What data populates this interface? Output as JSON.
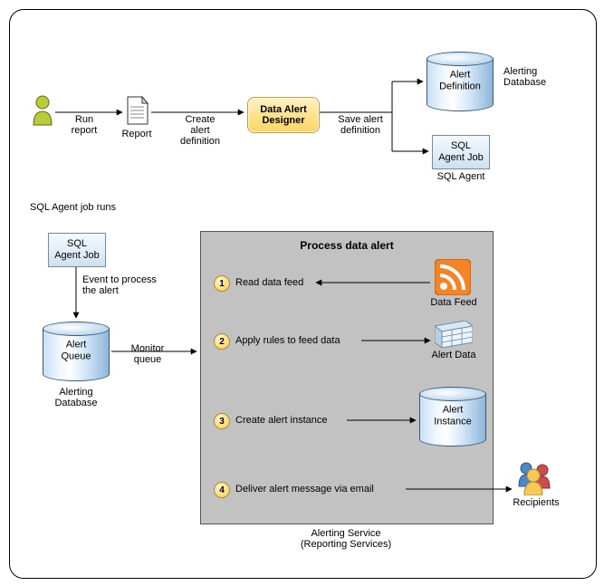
{
  "top": {
    "run_report": "Run\nreport",
    "report_label": "Report",
    "create_def": "Create\nalert\ndefinition",
    "designer": "Data Alert\nDesigner",
    "save_def": "Save alert\ndefinition",
    "alert_def_cyl": "Alert\nDefinition",
    "alerting_db_label": "Alerting\nDatabase",
    "sql_job": "SQL\nAgent Job",
    "sql_agent_label": "SQL Agent"
  },
  "mid": {
    "sql_runs": "SQL Agent job runs",
    "sql_job": "SQL\nAgent Job",
    "event_process": "Event to process\nthe alert",
    "alert_queue": "Alert\nQueue",
    "alerting_db_label": "Alerting\nDatabase",
    "monitor_queue": "Monitor\nqueue"
  },
  "process": {
    "title": "Process data alert",
    "steps": [
      {
        "num": "1",
        "label": "Read data feed",
        "target": "Data Feed"
      },
      {
        "num": "2",
        "label": "Apply rules to feed data",
        "target": "Alert Data"
      },
      {
        "num": "3",
        "label": "Create alert instance",
        "target": "Alert\nInstance"
      },
      {
        "num": "4",
        "label": "Deliver alert message via email",
        "target": ""
      }
    ],
    "service_label": "Alerting Service\n(Reporting Services)",
    "recipients": "Recipients"
  }
}
